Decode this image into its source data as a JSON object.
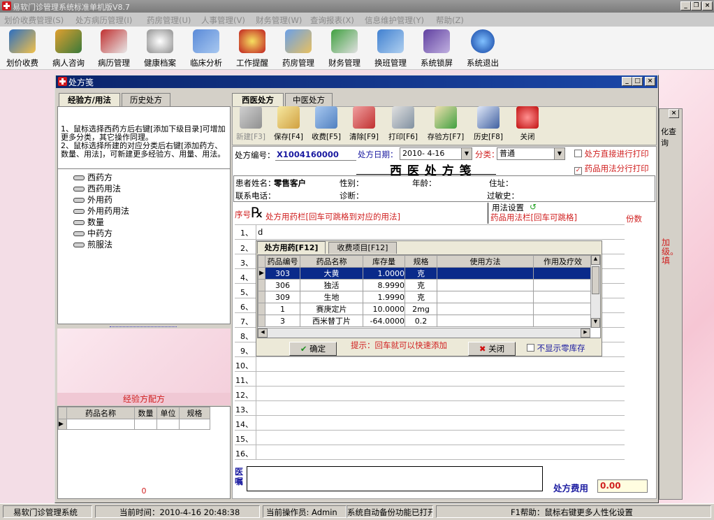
{
  "app": {
    "title": "易软门诊管理系统标准单机版V8.7"
  },
  "menu": [
    "划价收费管理(S)",
    "处方病历管理(I)",
    "药房管理(U)",
    "人事管理(V)",
    "财务管理(W)",
    "查询报表(X)",
    "信息维护管理(Y)",
    "帮助(Z)"
  ],
  "toolbar": [
    "划价收费",
    "病人咨询",
    "病历管理",
    "健康档案",
    "临床分析",
    "工作提醒",
    "药房管理",
    "财务管理",
    "换班管理",
    "系统锁屏",
    "系统退出"
  ],
  "window": {
    "title": "处方笺"
  },
  "left": {
    "tabs": [
      "经验方/用法",
      "历史处方"
    ],
    "hint": "1、鼠标选择西药方后右键[添加下级目录]可增加更多分类，其它操作同理。\n2、鼠标选择所建的对应分类后右键[添加药方、数量、用法]，可新建更多经验方、用量、用法。",
    "tree": [
      "西药方",
      "西药用法",
      "外用药",
      "外用药用法",
      "数量",
      "中药方",
      "煎服法"
    ],
    "formula_title": "经验方配方",
    "formula_cols": [
      "药品名称",
      "数量",
      "单位",
      "规格"
    ],
    "count": "0"
  },
  "rx": {
    "tabs": [
      "西医处方",
      "中医处方"
    ],
    "tools": [
      "新建[F3]",
      "保存[F4]",
      "收费[F5]",
      "清除[F9]",
      "打印[F6]",
      "存验方[F7]",
      "历史[F8]",
      "关闭"
    ],
    "no_label": "处方编号：",
    "no_value": "X1004160000",
    "date_label": "处方日期：",
    "date_value": "2010- 4-16",
    "class_label": "分类：",
    "class_value": "普通",
    "opt1": "处方直接进行打印",
    "opt2": "药品用法分行打印",
    "heading": "西 医 处 方 笺",
    "patient_label": "患者姓名：",
    "patient_value": "零售客户",
    "sex": "性别：",
    "age": "年龄：",
    "addr": "住址：",
    "phone": "联系电话：",
    "diag": "诊断：",
    "allergy": "过敏史：",
    "seq": "序号",
    "rx_hint": "处方用药栏[回车可跳格到对应的用法]",
    "usage_set": "用法设置",
    "usage_hint": "药品用法栏[回车可跳格]",
    "qty": "份数",
    "row1_text": "d",
    "rows": [
      "1、",
      "2、",
      "3、",
      "4、",
      "5、",
      "6、",
      "7、",
      "8、",
      "9、",
      "10、",
      "11、",
      "12、",
      "13、",
      "14、",
      "15、",
      "16、"
    ],
    "doctor_label": "医嘱",
    "fee_label": "处方费用",
    "fee_value": "0.00"
  },
  "popup": {
    "tabs": [
      "处方用药[F12]",
      "收费项目[F12]"
    ],
    "cols": [
      "药品编号",
      "药品名称",
      "库存量",
      "规格",
      "使用方法",
      "作用及疗效"
    ],
    "rows": [
      [
        "303",
        "大黄",
        "1.0000",
        "克"
      ],
      [
        "306",
        "独活",
        "8.9990",
        "克"
      ],
      [
        "309",
        "生地",
        "1.9990",
        "克"
      ],
      [
        "1",
        "赛庚定片",
        "10.0000",
        "2mg"
      ],
      [
        "3",
        "西米替丁片",
        "-64.0000",
        "0.2"
      ]
    ],
    "ok": "确定",
    "tip": "提示：回车就可以快速添加",
    "close": "关闭",
    "hide_zero": "不显示零库存"
  },
  "bg": {
    "right_text": "化查询",
    "red_text": "加\n级。\n填"
  },
  "status": [
    "易软门诊管理系统",
    "当前时间：2010-4-16 20:48:38",
    "当前操作员: Admin",
    "系统自动备份功能已打开",
    "F1帮助：鼠标右键更多人性化设置"
  ]
}
